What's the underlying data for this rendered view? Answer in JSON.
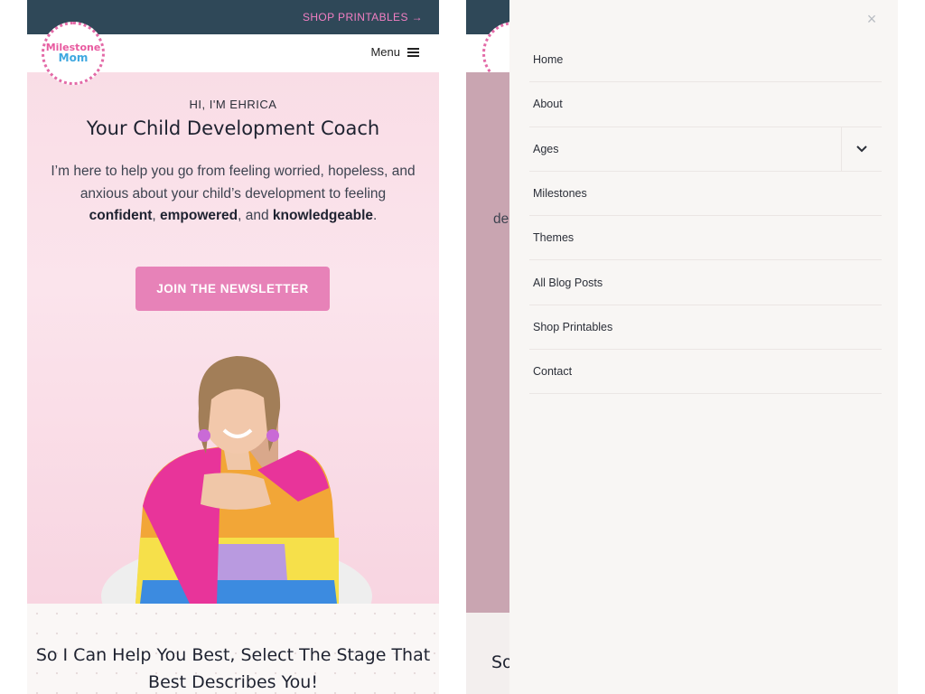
{
  "topbar": {
    "shop_link": "SHOP PRINTABLES →"
  },
  "logo": {
    "line1": "Milestone",
    "line2": "Mom"
  },
  "header": {
    "menu_label": "Menu"
  },
  "hero": {
    "eyebrow": "HI, I'M EHRICA",
    "title": "Your Child Development Coach",
    "intro_part1": "I’m here to help you go from feeling worried, hopeless, and anxious about your child’s development to feeling ",
    "bold1": "confident",
    "sep1": ", ",
    "bold2": "empowered",
    "sep2": ", and ",
    "bold3": "knowledgeable",
    "end": ".",
    "newsletter_button": "JOIN THE NEWSLETTER"
  },
  "section2": {
    "title": "So I Can Help You Best, Select The Stage That Best Describes You!"
  },
  "peek": {
    "intro_fragment": "de",
    "title_fragment": "So"
  },
  "drawer": {
    "close_icon": "×",
    "items": [
      {
        "label": "Home"
      },
      {
        "label": "About"
      },
      {
        "label": "Ages",
        "has_submenu": true
      },
      {
        "label": "Milestones"
      },
      {
        "label": "Themes"
      },
      {
        "label": "All Blog Posts"
      },
      {
        "label": "Shop Printables"
      },
      {
        "label": "Contact"
      }
    ]
  },
  "colors": {
    "topbar": "#2f4858",
    "accent": "#e782b8",
    "shop_link": "#f27fc3"
  }
}
